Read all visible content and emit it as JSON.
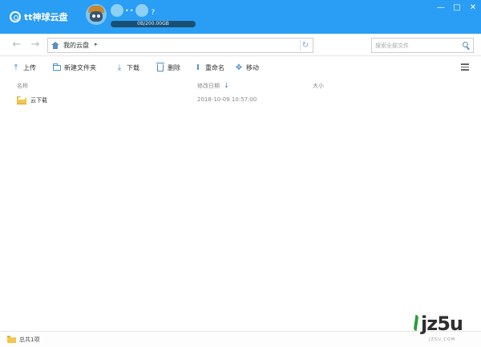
{
  "app": {
    "logo_text": "tt神球云盘",
    "user_suffix": "?",
    "user_dots": "••",
    "quota_text": "0B/200.00GB",
    "window_buttons": [
      "—",
      "□",
      "✕"
    ]
  },
  "nav": {
    "back_icon": "arrow-left-icon",
    "forward_icon": "arrow-right-icon",
    "breadcrumb": "我的云盘",
    "breadcrumb_arrow": "▸",
    "refresh_icon": "refresh-icon",
    "search_placeholder": "搜索全部文件"
  },
  "toolbar": {
    "upload": "上传",
    "new_folder": "新建文件夹",
    "download": "下载",
    "delete": "删除",
    "rename": "重命名",
    "move": "移动"
  },
  "columns": {
    "name": "名称",
    "modified": "修改日期",
    "size": "大小"
  },
  "files": [
    {
      "name": "云下载",
      "modified": "2018-10-09 10:57:00",
      "size": ""
    }
  ],
  "status": {
    "text": "总共1项"
  },
  "watermark": {
    "text": "jz5u",
    "sub": "JZ5U.COM"
  },
  "colors": {
    "titlebar": "#2a9df4",
    "accent": "#4a90c8",
    "folder": "#f3c64d"
  }
}
